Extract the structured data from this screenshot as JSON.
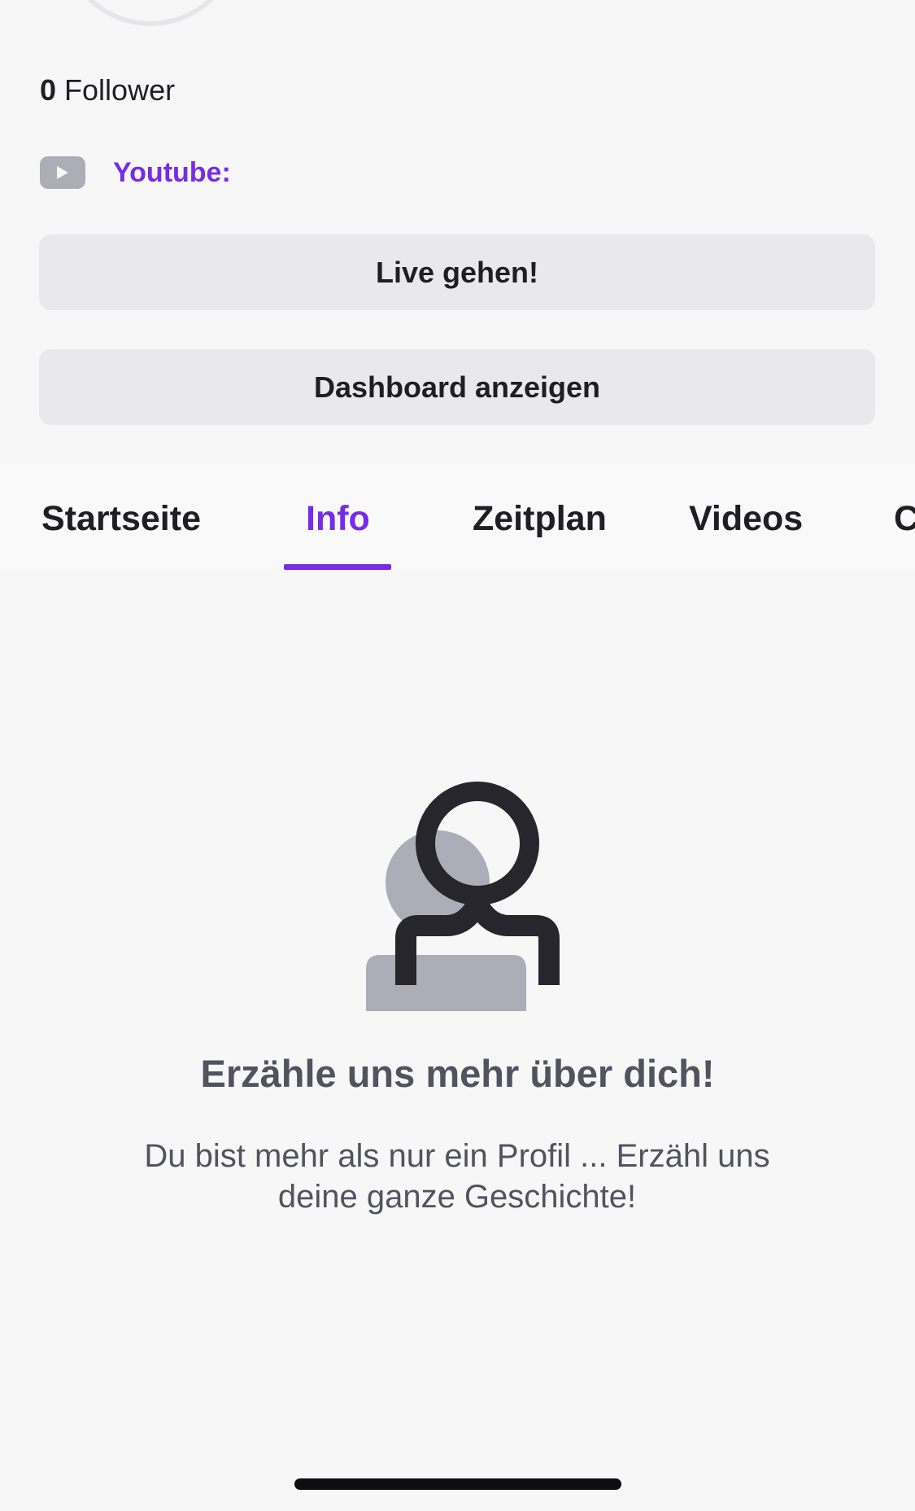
{
  "profile": {
    "follower_count": "0",
    "follower_label": "Follower"
  },
  "social": {
    "youtube_icon": "youtube-play-icon",
    "youtube_label": "Youtube:"
  },
  "actions": {
    "live_label": "Live gehen!",
    "dashboard_label": "Dashboard anzeigen"
  },
  "tabs": {
    "items": [
      {
        "label": "Startseite"
      },
      {
        "label": "Info",
        "active": true
      },
      {
        "label": "Zeitplan"
      },
      {
        "label": "Videos"
      },
      {
        "label": "C"
      }
    ]
  },
  "empty_state": {
    "illustration_icon": "person-placeholder-icon",
    "title": "Erzähle uns mehr über dich!",
    "line1": "Du bist mehr als nur ein Profil ... Erzähl uns",
    "line2": "deine ganze Geschichte!"
  },
  "colors": {
    "accent": "#772ce8",
    "background": "#f7f7f8",
    "button_bg": "#e9e9ec",
    "text_primary": "#1f1f23",
    "text_muted": "#53535f",
    "icon_gray": "#adadb8"
  }
}
